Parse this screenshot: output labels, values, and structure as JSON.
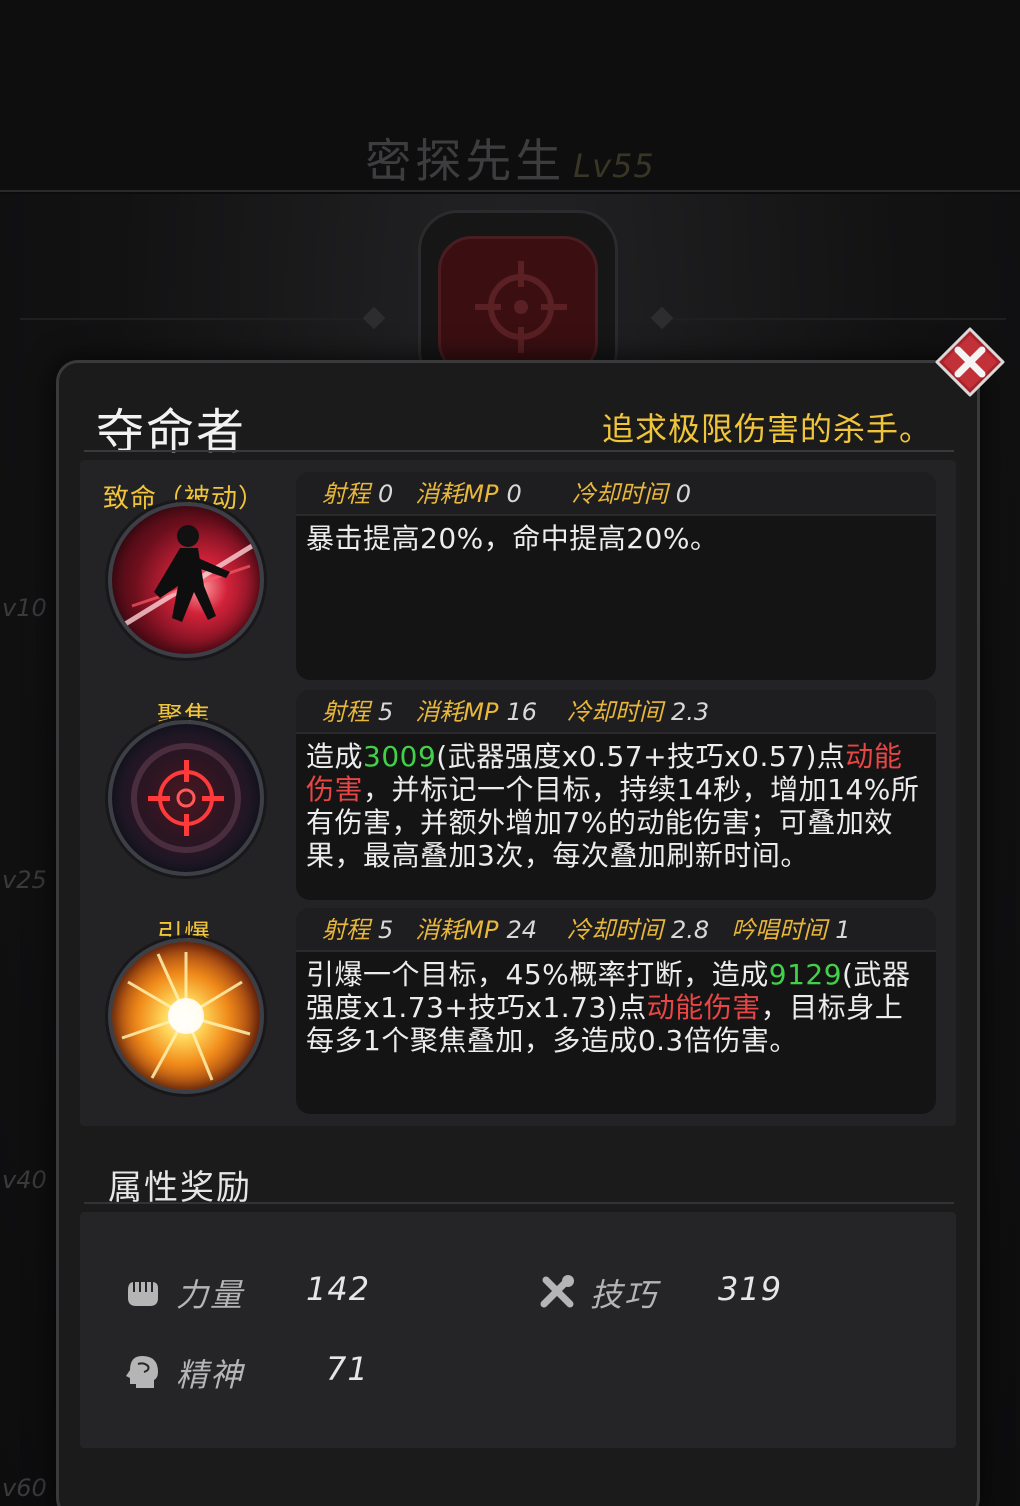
{
  "background": {
    "character_name": "密探先生",
    "character_level": "Lv55",
    "level_markers": [
      "v10",
      "v25",
      "v40",
      "v60"
    ]
  },
  "class_panel": {
    "class_name": "夺命者",
    "class_description": "追求极限伤害的杀手。",
    "close_icon": "close-x-icon",
    "skills": [
      {
        "name": "致命（被动）",
        "icon": "assassin-slash-icon",
        "stats": [
          {
            "label": "射程",
            "value": "0"
          },
          {
            "label": "消耗MP",
            "value": "0"
          },
          {
            "label": "冷却时间",
            "value": "0"
          }
        ],
        "desc": [
          {
            "text": "暴击提高20%，命中提高20%。",
            "color": "white"
          }
        ]
      },
      {
        "name": "聚焦",
        "icon": "crosshair-target-icon",
        "stats": [
          {
            "label": "射程",
            "value": "5"
          },
          {
            "label": "消耗MP",
            "value": "16"
          },
          {
            "label": "冷却时间",
            "value": "2.3"
          }
        ],
        "desc": [
          {
            "text": "造成",
            "color": "white"
          },
          {
            "text": "3009",
            "color": "green"
          },
          {
            "text": "(武器强度x0.57+技巧x0.57)点",
            "color": "white"
          },
          {
            "text": "动能伤害",
            "color": "red"
          },
          {
            "text": "，并标记一个目标，持续14秒，增加14%所有伤害，并额外增加7%的动能伤害；可叠加效果，最高叠加3次，每次叠加刷新时间。",
            "color": "white"
          }
        ]
      },
      {
        "name": "引爆",
        "icon": "explosion-burst-icon",
        "stats": [
          {
            "label": "射程",
            "value": "5"
          },
          {
            "label": "消耗MP",
            "value": "24"
          },
          {
            "label": "冷却时间",
            "value": "2.8"
          },
          {
            "label": "吟唱时间",
            "value": "1"
          }
        ],
        "desc": [
          {
            "text": "引爆一个目标，45%概率打断，造成",
            "color": "white"
          },
          {
            "text": "9129",
            "color": "green"
          },
          {
            "text": "(武器强度x1.73+技巧x1.73)点",
            "color": "white"
          },
          {
            "text": "动能伤害",
            "color": "red"
          },
          {
            "text": "，目标身上每多1个聚焦叠加，多造成0.3倍伤害。",
            "color": "white"
          }
        ]
      }
    ],
    "attributes_title": "属性奖励",
    "attributes": [
      {
        "icon": "fist-icon",
        "label": "力量",
        "value": "142"
      },
      {
        "icon": "tools-icon",
        "label": "技巧",
        "value": "319"
      },
      {
        "icon": "brain-head-icon",
        "label": "精神",
        "value": "71"
      }
    ]
  },
  "colors": {
    "accent_gold": "#f0c53a",
    "value_green": "#42d049",
    "damage_red": "#e84545",
    "close_button_red": "#b32830"
  }
}
